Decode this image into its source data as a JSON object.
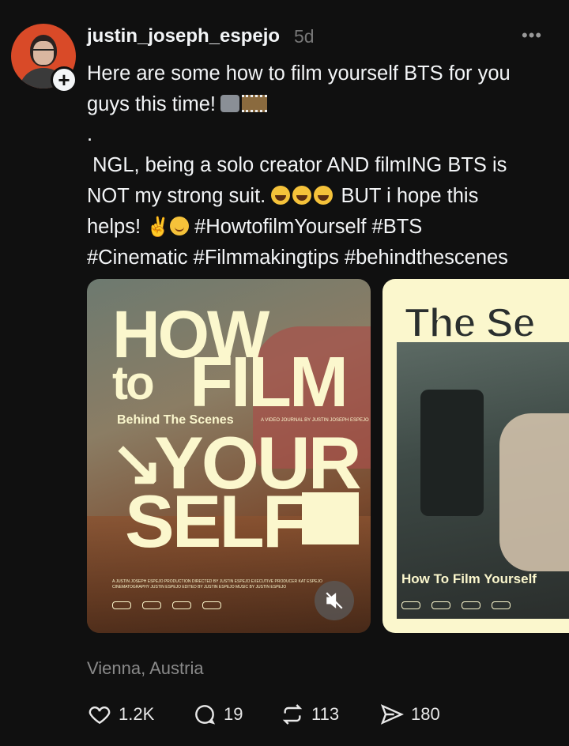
{
  "post": {
    "username": "justin_joseph_espejo",
    "timestamp": "5d",
    "lines": [
      "Here are some how to film yourself BTS for you",
      "guys this time!",
      ".",
      " NGL, being a solo creator AND filmING BTS is",
      "NOT my strong suit.",
      "BUT i hope this",
      "helps!",
      "#HowtofilmYourself #BTS",
      "#Cinematic #Filmmakingtips #behindthescenes"
    ],
    "location": "Vienna, Austria"
  },
  "media": {
    "card1": {
      "how": "HOW",
      "to": "to",
      "film": "FILM",
      "subtitle": "Behind The Scenes",
      "credit": "A VIDEO JOURNAL BY JUSTIN JOSEPH ESPEJO",
      "arrow": "↘",
      "your": "YOUR",
      "self": "SELF",
      "small_credits": "A JUSTIN JOSEPH ESPEJO PRODUCTION   DIRECTED BY JUSTIN ESPEJO   EXECUTIVE PRODUCER KAT ESPEJO   CINEMATOGRAPHY JUSTIN ESPEJO   EDITED BY JUSTIN ESPEJO   MUSIC BY JUSTIN ESPEJO"
    },
    "card2": {
      "title": "The Se",
      "subtitle": "How To Film Yourself"
    }
  },
  "actions": {
    "likes": "1.2K",
    "replies": "19",
    "reposts": "113",
    "shares": "180"
  },
  "colors": {
    "background": "#101010",
    "poster_cream": "#fbf7cd",
    "avatar_bg": "#d94a28",
    "muted_text": "#8a8a8a"
  },
  "icons": [
    "plus-icon",
    "more-icon",
    "mute-icon",
    "heart-icon",
    "reply-icon",
    "repost-icon",
    "share-icon"
  ]
}
